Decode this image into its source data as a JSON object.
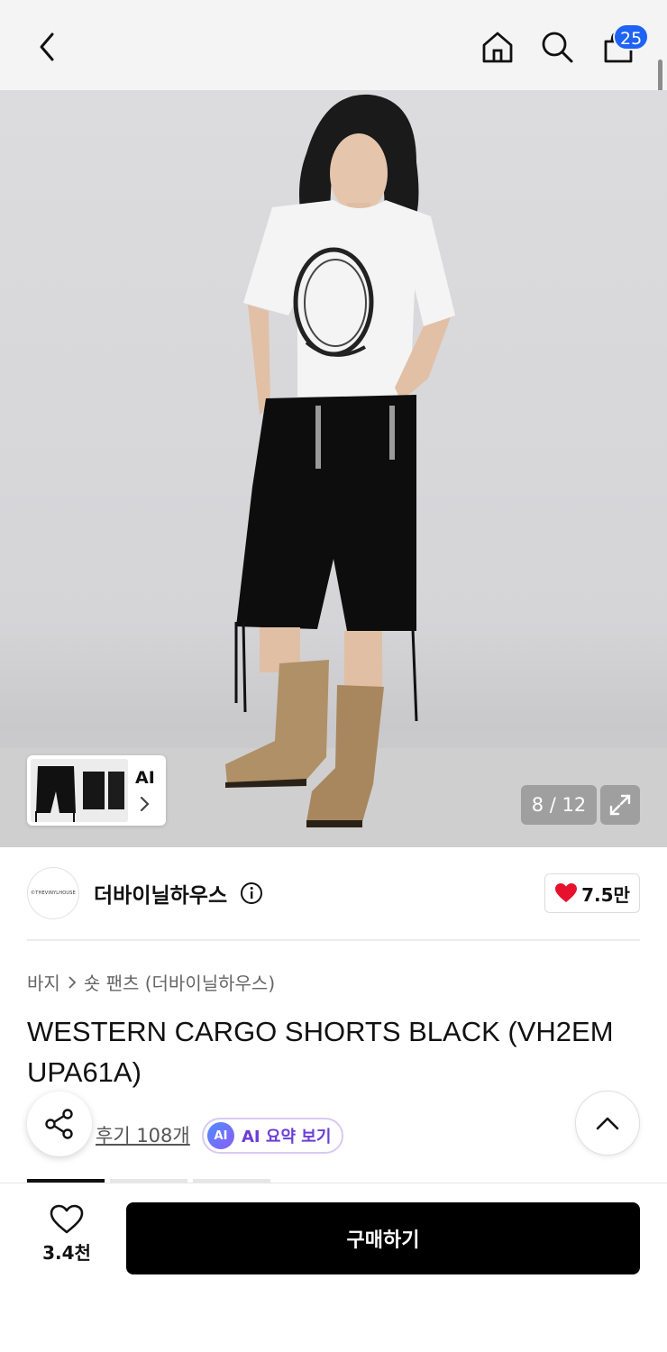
{
  "header": {
    "cart_count": "25"
  },
  "hero": {
    "counter": "8 / 12",
    "ai_label": "AI"
  },
  "brand": {
    "logo_text": "©THEVINYLHOUSE",
    "name": "더바이닐하우스",
    "likes": "7.5만"
  },
  "product": {
    "breadcrumb": [
      "바지",
      "숏 팬츠 (더바이닐하우스)"
    ],
    "title": "WESTERN CARGO SHORTS BLACK (VH2EM UPA61A)",
    "reviews_label": "후기 108개",
    "ai_summary_label": "AI 요약 보기",
    "ai_badge": "AI"
  },
  "bottom": {
    "wish_count": "3.4천",
    "buy_label": "구매하기"
  },
  "colors": {
    "badge": "#1e63f4",
    "heart": "#e8112d",
    "ai_accent": "#6b3fd6",
    "buy_bg": "#000000"
  },
  "icons": [
    "back-icon",
    "home-icon",
    "search-icon",
    "cart-icon",
    "expand-icon",
    "info-icon",
    "heart-icon",
    "share-icon",
    "chevron-up-icon",
    "heart-outline-icon"
  ]
}
